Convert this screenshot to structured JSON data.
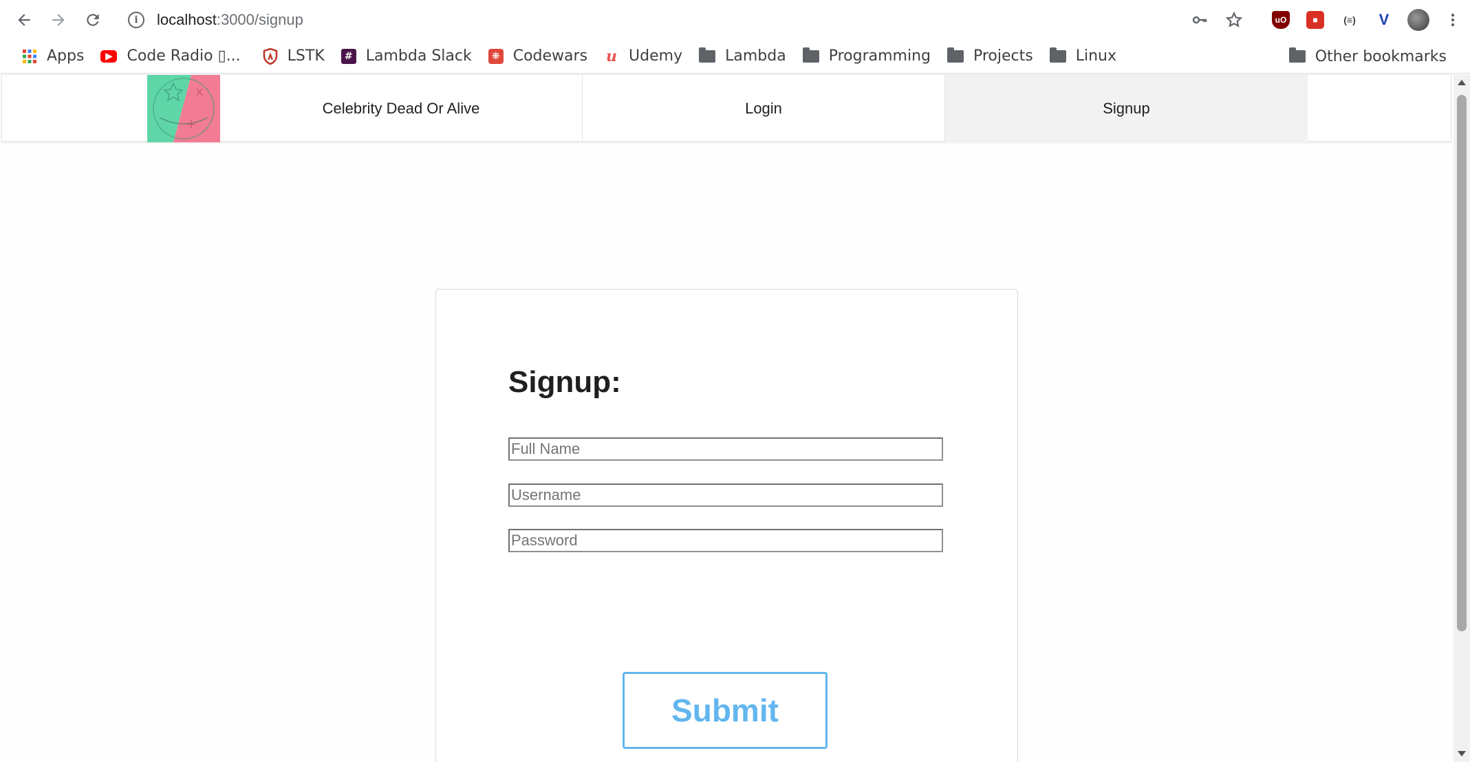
{
  "browser": {
    "url_host": "localhost",
    "url_path": ":3000/signup",
    "back_icon": "arrow-left-icon",
    "forward_icon": "arrow-right-icon",
    "reload_icon": "reload-icon"
  },
  "bookmarks": {
    "items": [
      {
        "label": "Apps",
        "icon": "apps-grid-icon"
      },
      {
        "label": "Code Radio ▯...",
        "icon": "youtube-icon",
        "color": "#ff0000"
      },
      {
        "label": "LSTK",
        "icon": "shield-icon",
        "color": "#c0392b"
      },
      {
        "label": "Lambda Slack",
        "icon": "slack-icon",
        "color": "#4a154b"
      },
      {
        "label": "Codewars",
        "icon": "codewars-icon",
        "color": "#e0483c"
      },
      {
        "label": "Udemy",
        "icon": "udemy-icon",
        "color": "#ec5252"
      },
      {
        "label": "Lambda",
        "icon": "folder-icon"
      },
      {
        "label": "Programming",
        "icon": "folder-icon"
      },
      {
        "label": "Projects",
        "icon": "folder-icon"
      },
      {
        "label": "Linux",
        "icon": "folder-icon"
      }
    ],
    "other": "Other bookmarks"
  },
  "site_nav": {
    "brand": "Celebrity Dead Or Alive",
    "login": "Login",
    "signup": "Signup"
  },
  "form": {
    "title": "Signup:",
    "full_name_placeholder": "Full Name",
    "username_placeholder": "Username",
    "password_placeholder": "Password",
    "submit_label": "Submit"
  },
  "colors": {
    "accent": "#62b6ee",
    "logo_green": "#5fd6a8",
    "logo_pink": "#f27c93",
    "active_tab_bg": "#f2f2f2"
  }
}
